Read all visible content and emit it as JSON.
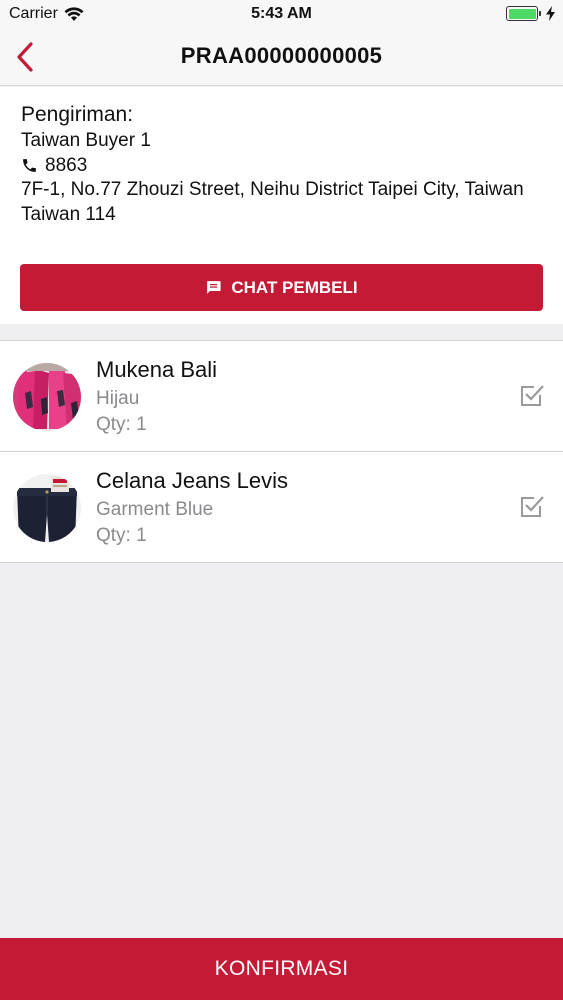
{
  "status_bar": {
    "carrier": "Carrier",
    "time": "5:43 AM",
    "battery_level": 1.0,
    "battery_color": "#4cd964"
  },
  "nav": {
    "back_icon": "chevron-left-icon",
    "title": "PRAA00000000005"
  },
  "shipping": {
    "heading": "Pengiriman:",
    "name": "Taiwan Buyer 1",
    "phone": "8863",
    "address": "7F-1, No.77 Zhouzi Street, Neihu District Taipei City, Taiwan",
    "country_zip": "Taiwan 114",
    "chat_button_label": "CHAT PEMBELI",
    "chat_icon": "chat-bubble-icon"
  },
  "products": [
    {
      "name": "Mukena Bali",
      "variant": "Hijau",
      "qty": "Qty: 1",
      "checked": true
    },
    {
      "name": "Celana Jeans Levis",
      "variant": "Garment Blue",
      "qty": "Qty: 1",
      "checked": true
    }
  ],
  "footer": {
    "confirm_label": "KONFIRMASI"
  },
  "colors": {
    "accent": "#c41a35",
    "muted_text": "#8a8a8e",
    "background": "#efeff1"
  }
}
